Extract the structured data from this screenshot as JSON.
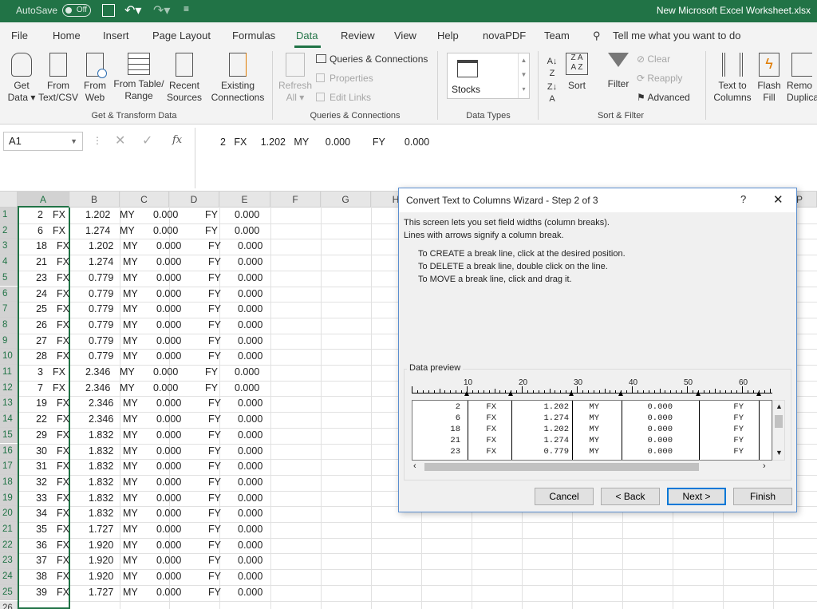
{
  "titlebar": {
    "autosave": "AutoSave",
    "toggle": "Off",
    "filename": "New Microsoft Excel Worksheet.xlsx"
  },
  "tabs": [
    "File",
    "Home",
    "Insert",
    "Page Layout",
    "Formulas",
    "Data",
    "Review",
    "View",
    "Help",
    "novaPDF",
    "Team"
  ],
  "tell_me": "Tell me what you want to do",
  "ribbon": {
    "get_data": [
      "Get",
      "Data ▾"
    ],
    "from_text": [
      "From",
      "Text/CSV"
    ],
    "from_web": [
      "From",
      "Web"
    ],
    "from_table": [
      "From Table/",
      "Range"
    ],
    "recent": [
      "Recent",
      "Sources"
    ],
    "existing": [
      "Existing",
      "Connections"
    ],
    "group1": "Get & Transform Data",
    "refresh": [
      "Refresh",
      "All ▾"
    ],
    "queries": "Queries & Connections",
    "properties": "Properties",
    "edit_links": "Edit Links",
    "group2": "Queries & Connections",
    "stocks": "Stocks",
    "group3": "Data Types",
    "sort": "Sort",
    "filter": "Filter",
    "clear": "Clear",
    "reapply": "Reapply",
    "advanced": "Advanced",
    "group4": "Sort & Filter",
    "text_to_columns": [
      "Text to",
      "Columns"
    ],
    "flash_fill": [
      "Flash",
      "Fill"
    ],
    "remove_dup": [
      "Remo",
      "Duplica"
    ]
  },
  "formula": {
    "namebox": "A1",
    "fx": "fx",
    "content": "2   FX     1.202   MY      0.000        FY       0.000"
  },
  "columns": [
    "A",
    "B",
    "C",
    "D",
    "E",
    "F",
    "G",
    "H",
    "P"
  ],
  "rows": [
    [
      "2",
      "FX",
      "1.202",
      "MY",
      "0.000",
      "FY",
      "0.000"
    ],
    [
      "6",
      "FX",
      "1.274",
      "MY",
      "0.000",
      "FY",
      "0.000"
    ],
    [
      "18",
      "FX",
      "1.202",
      "MY",
      "0.000",
      "FY",
      "0.000"
    ],
    [
      "21",
      "FX",
      "1.274",
      "MY",
      "0.000",
      "FY",
      "0.000"
    ],
    [
      "23",
      "FX",
      "0.779",
      "MY",
      "0.000",
      "FY",
      "0.000"
    ],
    [
      "24",
      "FX",
      "0.779",
      "MY",
      "0.000",
      "FY",
      "0.000"
    ],
    [
      "25",
      "FX",
      "0.779",
      "MY",
      "0.000",
      "FY",
      "0.000"
    ],
    [
      "26",
      "FX",
      "0.779",
      "MY",
      "0.000",
      "FY",
      "0.000"
    ],
    [
      "27",
      "FX",
      "0.779",
      "MY",
      "0.000",
      "FY",
      "0.000"
    ],
    [
      "28",
      "FX",
      "0.779",
      "MY",
      "0.000",
      "FY",
      "0.000"
    ],
    [
      "3",
      "FX",
      "2.346",
      "MY",
      "0.000",
      "FY",
      "0.000"
    ],
    [
      "7",
      "FX",
      "2.346",
      "MY",
      "0.000",
      "FY",
      "0.000"
    ],
    [
      "19",
      "FX",
      "2.346",
      "MY",
      "0.000",
      "FY",
      "0.000"
    ],
    [
      "22",
      "FX",
      "2.346",
      "MY",
      "0.000",
      "FY",
      "0.000"
    ],
    [
      "29",
      "FX",
      "1.832",
      "MY",
      "0.000",
      "FY",
      "0.000"
    ],
    [
      "30",
      "FX",
      "1.832",
      "MY",
      "0.000",
      "FY",
      "0.000"
    ],
    [
      "31",
      "FX",
      "1.832",
      "MY",
      "0.000",
      "FY",
      "0.000"
    ],
    [
      "32",
      "FX",
      "1.832",
      "MY",
      "0.000",
      "FY",
      "0.000"
    ],
    [
      "33",
      "FX",
      "1.832",
      "MY",
      "0.000",
      "FY",
      "0.000"
    ],
    [
      "34",
      "FX",
      "1.832",
      "MY",
      "0.000",
      "FY",
      "0.000"
    ],
    [
      "35",
      "FX",
      "1.727",
      "MY",
      "0.000",
      "FY",
      "0.000"
    ],
    [
      "36",
      "FX",
      "1.920",
      "MY",
      "0.000",
      "FY",
      "0.000"
    ],
    [
      "37",
      "FX",
      "1.920",
      "MY",
      "0.000",
      "FY",
      "0.000"
    ],
    [
      "38",
      "FX",
      "1.920",
      "MY",
      "0.000",
      "FY",
      "0.000"
    ],
    [
      "39",
      "FX",
      "1.727",
      "MY",
      "0.000",
      "FY",
      "0.000"
    ]
  ],
  "dialog": {
    "title": "Convert Text to Columns Wizard - Step 2 of 3",
    "help": "?",
    "close": "✕",
    "intro1": "This screen lets you set field widths (column breaks).",
    "intro2": "Lines with arrows signify a column break.",
    "create": "To CREATE a break line, click at the desired position.",
    "delete": "To DELETE a break line, double click on the line.",
    "move": "To MOVE a break line, click and drag it.",
    "preview_label": "Data preview",
    "ruler": [
      "10",
      "20",
      "30",
      "40",
      "50",
      "60"
    ],
    "preview_rows": [
      [
        "2",
        "FX",
        "1.202",
        "MY",
        "0.000",
        "FY"
      ],
      [
        "6",
        "FX",
        "1.274",
        "MY",
        "0.000",
        "FY"
      ],
      [
        "18",
        "FX",
        "1.202",
        "MY",
        "0.000",
        "FY"
      ],
      [
        "21",
        "FX",
        "1.274",
        "MY",
        "0.000",
        "FY"
      ],
      [
        "23",
        "FX",
        "0.779",
        "MY",
        "0.000",
        "FY"
      ]
    ],
    "cancel": "Cancel",
    "back": "< Back",
    "next": "Next >",
    "finish": "Finish"
  }
}
